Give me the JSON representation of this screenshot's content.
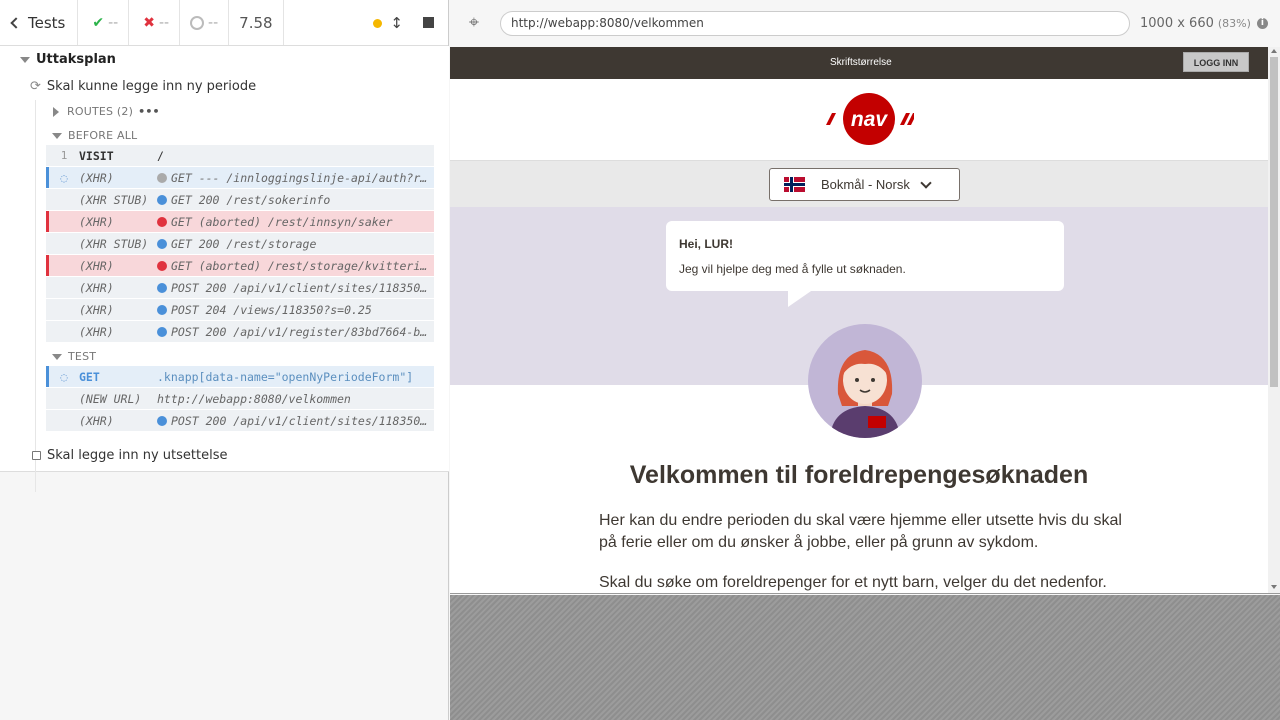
{
  "reporter": {
    "header": {
      "tests_label": "Tests",
      "passed": "--",
      "failed": "--",
      "pending": "--",
      "duration": "7.58"
    },
    "suite": "Uttaksplan",
    "test1": "Skal kunne legge inn ny periode",
    "routes_label": "ROUTES (2)",
    "routes_more": "•••",
    "before_all_label": "BEFORE ALL",
    "test_label": "TEST",
    "before_all_commands": [
      {
        "num": "1",
        "name": "VISIT",
        "msg": "/",
        "state": "normal"
      },
      {
        "num": "",
        "name": "(XHR)",
        "msg": "GET --- /innloggingslinje-api/auth?r…",
        "state": "pending",
        "dot": "#aaaaaa"
      },
      {
        "num": "",
        "name": "(XHR STUB)",
        "msg": "GET 200 /rest/sokerinfo",
        "state": "normal",
        "dot": "#4a90d9"
      },
      {
        "num": "",
        "name": "(XHR)",
        "msg": "GET (aborted) /rest/innsyn/saker",
        "state": "failed",
        "dot": "#e0323e"
      },
      {
        "num": "",
        "name": "(XHR STUB)",
        "msg": "GET 200 /rest/storage",
        "state": "normal",
        "dot": "#4a90d9"
      },
      {
        "num": "",
        "name": "(XHR)",
        "msg": "GET (aborted) /rest/storage/kvitteri…",
        "state": "failed",
        "dot": "#e0323e"
      },
      {
        "num": "",
        "name": "(XHR)",
        "msg": "POST 200 /api/v1/client/sites/118350…",
        "state": "normal",
        "dot": "#4a90d9"
      },
      {
        "num": "",
        "name": "(XHR)",
        "msg": "POST 204 /views/118350?s=0.25",
        "state": "normal",
        "dot": "#4a90d9"
      },
      {
        "num": "",
        "name": "(XHR)",
        "msg": "POST 200 /api/v1/register/83bd7664-b…",
        "state": "normal",
        "dot": "#4a90d9"
      }
    ],
    "test_commands": [
      {
        "num": "",
        "name": "GET",
        "msg": ".knapp[data-name=\"openNyPeriodeForm\"]",
        "state": "pending"
      },
      {
        "num": "",
        "name": "(NEW URL)",
        "msg": "http://webapp:8080/velkommen",
        "state": "normal"
      },
      {
        "num": "",
        "name": "(XHR)",
        "msg": "POST 200 /api/v1/client/sites/118350…",
        "state": "normal",
        "dot": "#4a90d9"
      }
    ],
    "test2": "Skal legge inn ny utsettelse"
  },
  "aut": {
    "url": "http://webapp:8080/velkommen",
    "viewport": "1000 x 660",
    "scale": "(83%)",
    "font_size_link": "Skriftstørrelse",
    "login_button": "LOGG INN",
    "language": "Bokmål - Norsk",
    "bubble_title": "Hei, LUR!",
    "bubble_text": "Jeg vil hjelpe deg med å fylle ut søknaden.",
    "welcome_title": "Velkommen til foreldrepengesøknaden",
    "intro_text": "Her kan du endre perioden du skal være hjemme eller utsette hvis du skal på ferie eller om du ønsker å jobbe, eller på grunn av sykdom.",
    "intro_text2": "Skal du søke om foreldrepenger for et nytt barn, velger du det nedenfor.",
    "logo_text": "nav"
  },
  "colors": {
    "nav_red": "#c30000",
    "pass": "#2bb34a",
    "fail": "#e0323e",
    "pending_blue": "#4a90d9"
  }
}
